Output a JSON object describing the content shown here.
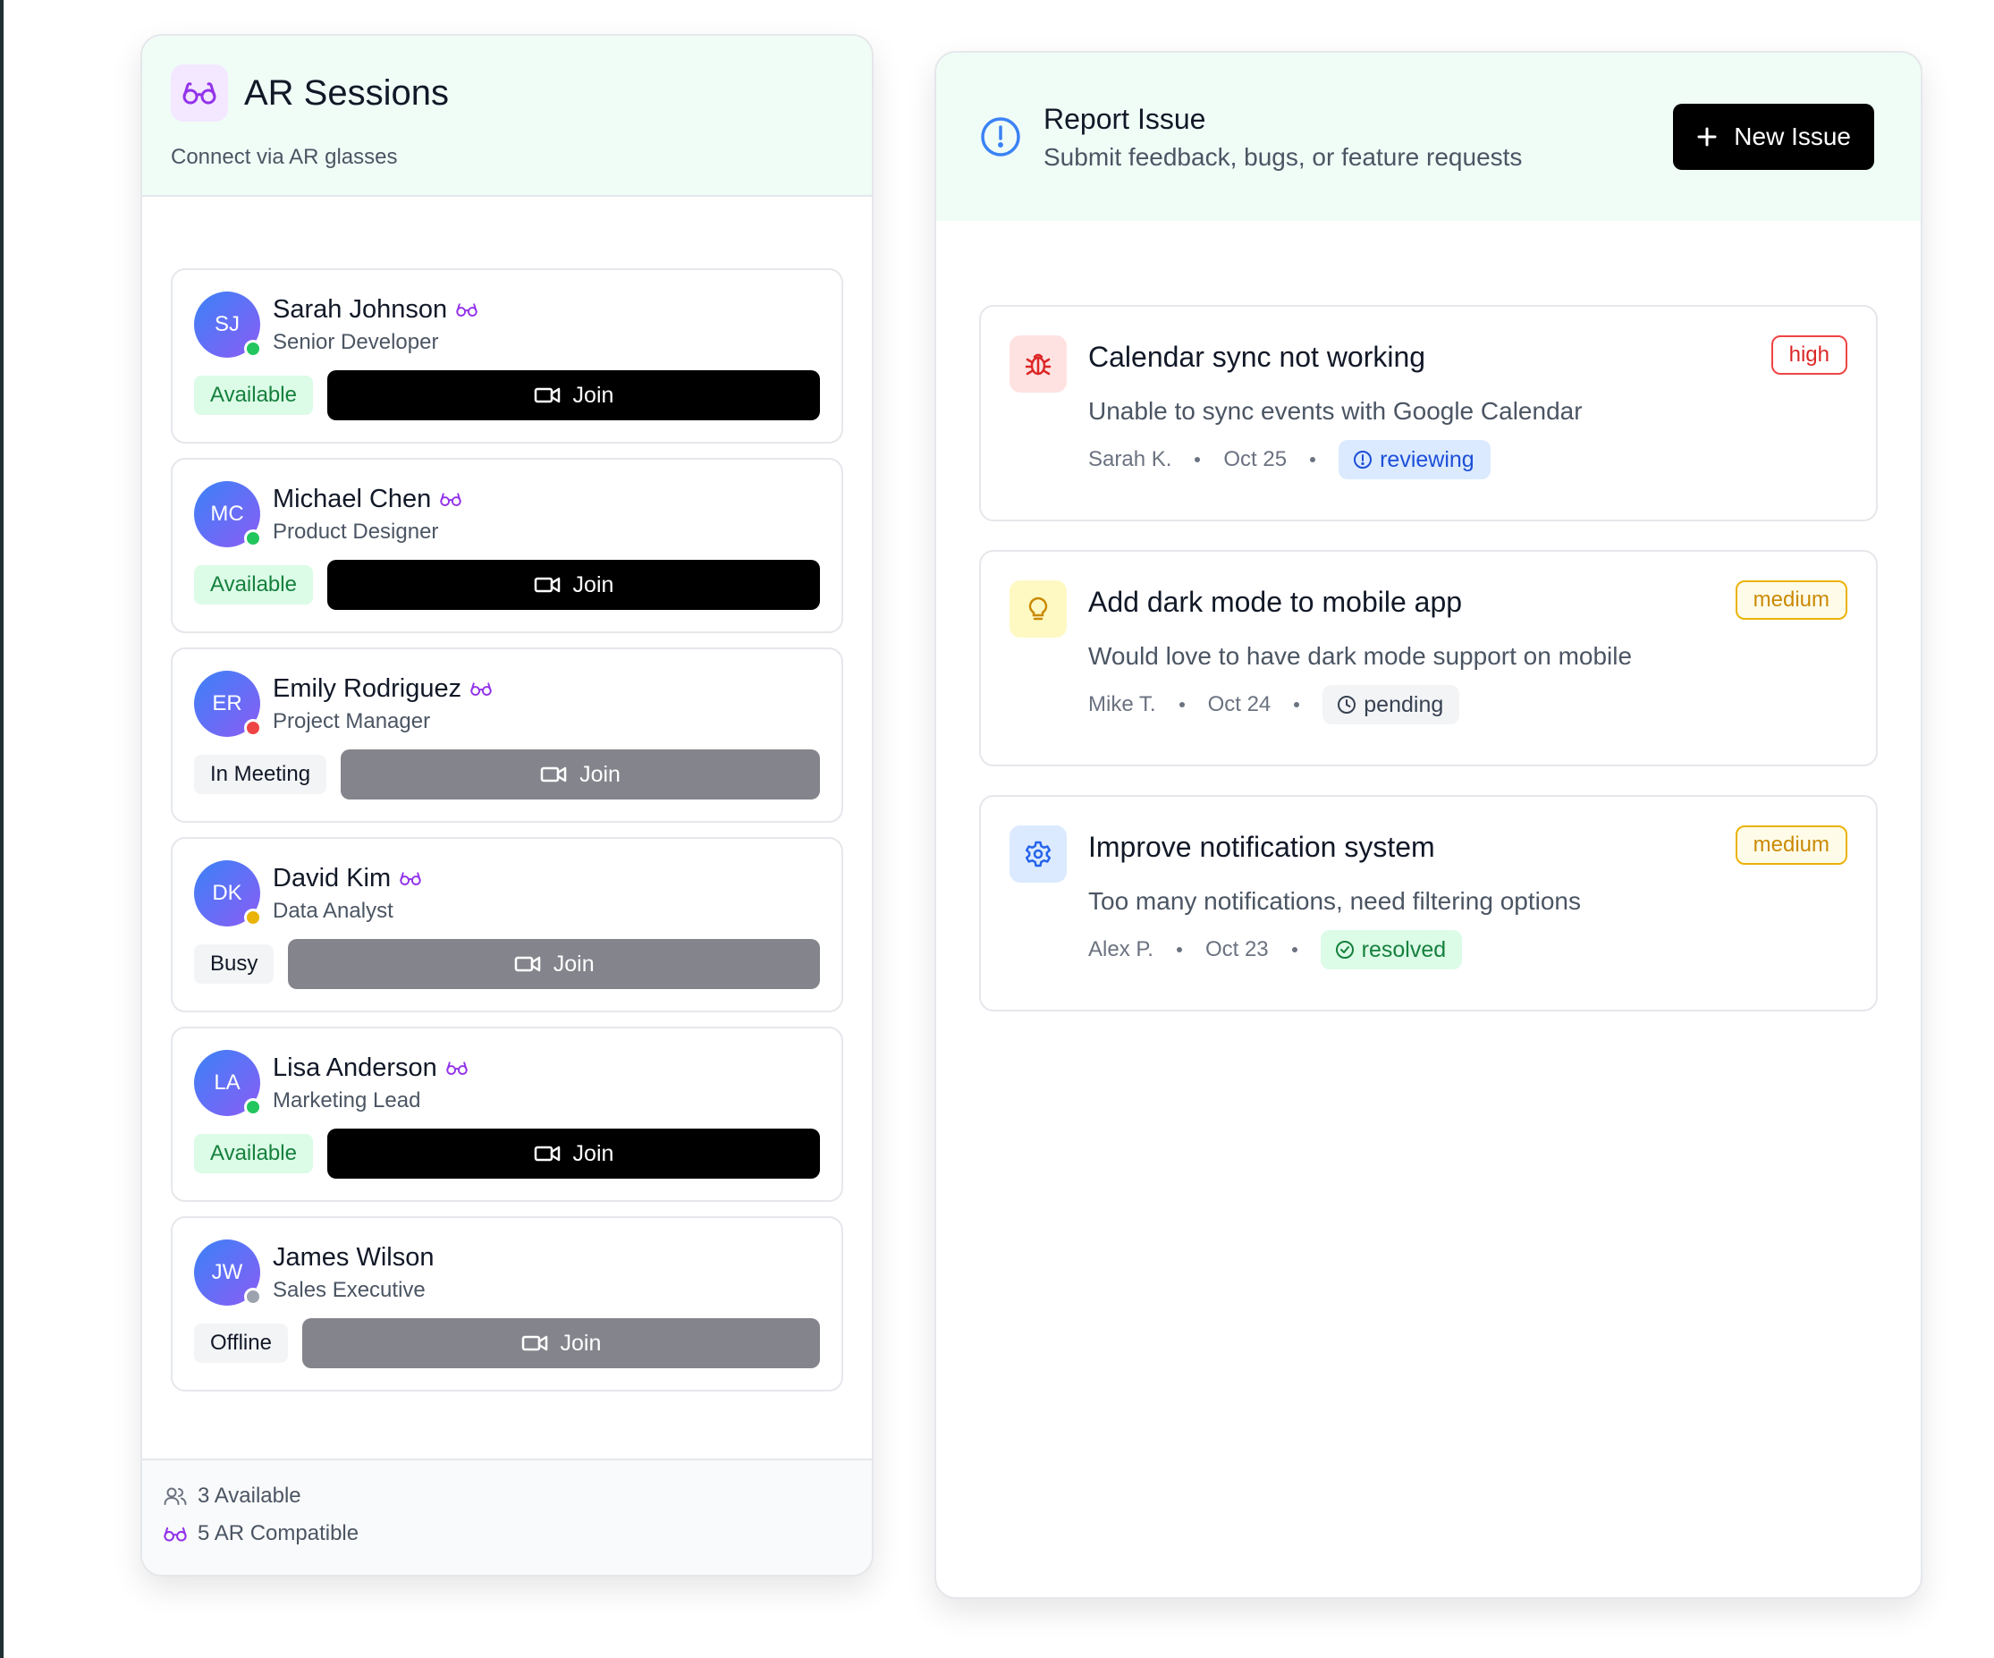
{
  "colors": {
    "accent_purple": "#9333ea",
    "available": "#22c55e",
    "meeting": "#ef4444",
    "busy": "#eab308",
    "offline": "#9ca3af"
  },
  "ar_sessions": {
    "title": "AR Sessions",
    "subtitle": "Connect via AR glasses",
    "join_label": "Join",
    "people": [
      {
        "initials": "SJ",
        "name": "Sarah Johnson",
        "role": "Senior Developer",
        "status": "Available",
        "ar": true
      },
      {
        "initials": "MC",
        "name": "Michael Chen",
        "role": "Product Designer",
        "status": "Available",
        "ar": true
      },
      {
        "initials": "ER",
        "name": "Emily Rodriguez",
        "role": "Project Manager",
        "status": "In Meeting",
        "ar": true
      },
      {
        "initials": "DK",
        "name": "David Kim",
        "role": "Data Analyst",
        "status": "Busy",
        "ar": true
      },
      {
        "initials": "LA",
        "name": "Lisa Anderson",
        "role": "Marketing Lead",
        "status": "Available",
        "ar": true
      },
      {
        "initials": "JW",
        "name": "James Wilson",
        "role": "Sales Executive",
        "status": "Offline",
        "ar": false
      }
    ],
    "footer": {
      "available": "3 Available",
      "ar_compatible": "5 AR Compatible"
    }
  },
  "report_issue": {
    "title": "Report Issue",
    "subtitle": "Submit feedback, bugs, or feature requests",
    "new_issue_label": "New Issue",
    "issues": [
      {
        "icon": "bug-icon",
        "title": "Calendar sync not working",
        "description": "Unable to sync events with Google Calendar",
        "author": "Sarah K.",
        "date": "Oct 25",
        "status": "reviewing",
        "priority": "high"
      },
      {
        "icon": "lightbulb-icon",
        "title": "Add dark mode to mobile app",
        "description": "Would love to have dark mode support on mobile",
        "author": "Mike T.",
        "date": "Oct 24",
        "status": "pending",
        "priority": "medium"
      },
      {
        "icon": "gear-icon",
        "title": "Improve notification system",
        "description": "Too many notifications, need filtering options",
        "author": "Alex P.",
        "date": "Oct 23",
        "status": "resolved",
        "priority": "medium"
      }
    ]
  }
}
